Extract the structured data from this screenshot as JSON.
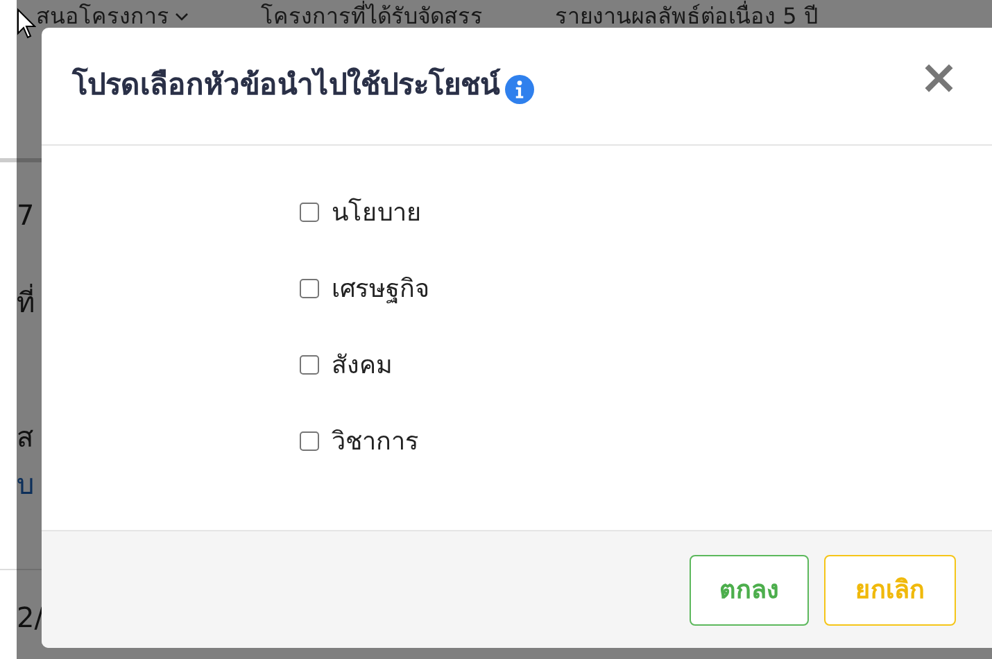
{
  "background": {
    "nav": [
      {
        "label": "สนอโครงการ",
        "dropdown": true
      },
      {
        "label": "โครงการที่ได้รับจัดสรร",
        "dropdown": false
      },
      {
        "label": "รายงานผลลัพธ์ต่อเนื่อง 5 ปี",
        "dropdown": false
      }
    ],
    "fragments": [
      {
        "text": "7",
        "kind": "text"
      },
      {
        "text": "ที่",
        "kind": "text"
      },
      {
        "text": "ส",
        "kind": "text"
      },
      {
        "text": "บ",
        "kind": "link"
      },
      {
        "text": "2/",
        "kind": "text"
      }
    ]
  },
  "dialog": {
    "title": "โปรดเลือกหัวข้อนำไปใช้ประโยชน์",
    "close": "×",
    "options": [
      {
        "label": "นโยบาย",
        "checked": false
      },
      {
        "label": "เศรษฐกิจ",
        "checked": false
      },
      {
        "label": "สังคม",
        "checked": false
      },
      {
        "label": "วิชาการ",
        "checked": false
      }
    ],
    "buttons": [
      {
        "label": "ตกลง",
        "kind": "confirm"
      },
      {
        "label": "ยกเลิก",
        "kind": "cancel"
      }
    ]
  }
}
